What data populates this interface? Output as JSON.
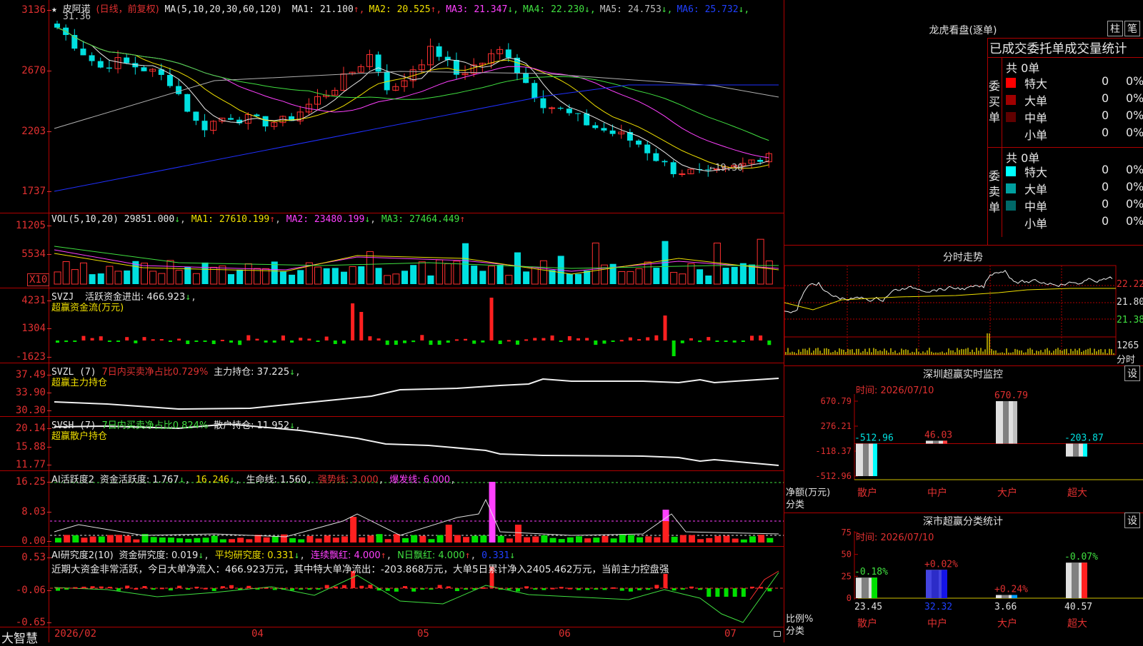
{
  "stock_name": "皮阿诺",
  "star_icon": "★",
  "period_label": "(日线，前复权)",
  "ma_header": {
    "label": "MA(5,10,20,30,60,120)",
    "items": [
      {
        "text": "MA1: 21.100",
        "arrow": "↑",
        "color": "#e8e8e8"
      },
      {
        "text": "MA2: 20.525",
        "arrow": "↑",
        "color": "#f0e000"
      },
      {
        "text": "MA3: 21.347",
        "arrow": "↓",
        "color": "#ff40ff"
      },
      {
        "text": "MA4: 22.230",
        "arrow": "↓",
        "color": "#40e040"
      },
      {
        "text": "MA5: 24.753",
        "arrow": "↓",
        "color": "#c0c0c0"
      },
      {
        "text": "MA6: 25.732",
        "arrow": "↓",
        "color": "#2040ff"
      }
    ]
  },
  "price_axis": [
    "3136",
    "2670",
    "2203",
    "1737"
  ],
  "price_annotations": {
    "high": "31.36",
    "low": "←19.30"
  },
  "vol_header": {
    "label": "VOL(5,10,20)",
    "value": "29851.000",
    "arrow": "↓",
    "ma1": "MA1: 27610.199",
    "ma1_arrow": "↑",
    "ma2": "MA2: 23480.199",
    "ma2_arrow": "↓",
    "ma3": "MA3: 27464.449",
    "ma3_arrow": "↑"
  },
  "vol_axis": [
    "11205",
    "5534"
  ],
  "vol_unit": "X10",
  "svzj": {
    "label": "SVZJ",
    "text": "活跃资金进出: 466.923",
    "arrow": "↓",
    "sub": "超赢资金流(万元)",
    "axis": [
      "4231",
      "1304",
      "-1623"
    ]
  },
  "svzl": {
    "label": "SVZL (7)",
    "ratio": "7日内买卖净占比0.729%",
    "text": "主力持仓: 37.225",
    "arrow": "↓",
    "sub": "超赢主力持仓",
    "axis": [
      "37.49",
      "33.90",
      "30.30"
    ]
  },
  "svsh": {
    "label": "SVSH (7)",
    "ratio": "7日内买卖净占比0.824%",
    "text": "散户持仓: 11.952",
    "arrow": "↓",
    "sub": "超赢散户持仓",
    "axis": [
      "20.14",
      "15.88",
      "11.77"
    ]
  },
  "ai_active": {
    "label": "AI活跃度2",
    "text": "资金活跃度: 1.767",
    "t2": "16.246",
    "t3": "生命线: 1.560",
    "t4": "强势线: 3.000",
    "t5": "爆发线: 6.000",
    "axis": [
      "16.25",
      "8.03",
      "0.00"
    ]
  },
  "ai_research": {
    "label": "AI研究度2(10)",
    "text": "资金研究度: 0.019",
    "t2": "平均研究度: 0.331",
    "t3": "连续飘红: 4.000",
    "t4": "N日飘红: 4.000",
    "t5": "0.331",
    "desc": "近期大资金非常活跃，今日大单净流入：466.923万元，其中特大单净流出：-203.868万元，大单5日累计净入2405.462万元，当前主力控盘强",
    "axis": [
      "0.53",
      "-0.06",
      "-0.65"
    ]
  },
  "x_axis": {
    "app": "大智慧",
    "labels": [
      "2026/02",
      "04",
      "05",
      "06",
      "07"
    ]
  },
  "dragon_tiger": {
    "title": "龙虎看盘(逐单)",
    "btn1": "柱",
    "btn2": "笔",
    "subtitle": "已成交委托单成交量统计",
    "buy": {
      "label": "委买单",
      "total": "共 0单",
      "rows": [
        {
          "name": "特大",
          "count": "0",
          "pct": "0%",
          "color": "#ff0000"
        },
        {
          "name": "大单",
          "count": "0",
          "pct": "0%",
          "color": "#a00000"
        },
        {
          "name": "中单",
          "count": "0",
          "pct": "0%",
          "color": "#600000"
        },
        {
          "name": "小单",
          "count": "0",
          "pct": "0%",
          "color": "#000000"
        }
      ]
    },
    "sell": {
      "label": "委卖单",
      "total": "共 0单",
      "rows": [
        {
          "name": "特大",
          "count": "0",
          "pct": "0%",
          "color": "#00ffff"
        },
        {
          "name": "大单",
          "count": "0",
          "pct": "0%",
          "color": "#00a0a0"
        },
        {
          "name": "中单",
          "count": "0",
          "pct": "0%",
          "color": "#006868"
        },
        {
          "name": "小单",
          "count": "0",
          "pct": "0%",
          "color": "#000000"
        }
      ]
    }
  },
  "intraday": {
    "title": "分时走势",
    "axis": [
      "22.22",
      "21.80",
      "21.38"
    ],
    "vol_label": "1265",
    "vol_unit": "分时"
  },
  "sz_monitor": {
    "title": "深圳超赢实时监控",
    "settings": "设",
    "time": "时间: 2026/07/10",
    "y_axis": [
      "670.79",
      "276.21",
      "-118.37",
      "-512.96"
    ],
    "ylabel": "净额(万元)",
    "xlabel": "分类",
    "categories": [
      "散户",
      "中户",
      "大户",
      "超大"
    ],
    "values": [
      -512.96,
      46.03,
      670.79,
      -203.87
    ],
    "value_labels": [
      "-512.96",
      "46.03",
      "670.79",
      "-203.87"
    ]
  },
  "sz_stats": {
    "title": "深市超赢分类统计",
    "settings": "设",
    "time": "时间: 2026/07/10",
    "y_axis": [
      "75",
      "50",
      "25",
      "0"
    ],
    "ylabel": "比例%",
    "xlabel": "分类",
    "categories": [
      "散户",
      "中户",
      "大户",
      "超大"
    ],
    "values": [
      23.45,
      32.32,
      3.66,
      40.57
    ],
    "value_labels": [
      "23.45",
      "32.32",
      "3.66",
      "40.57"
    ],
    "changes": [
      "-0.18%",
      "+0.02%",
      "+0.24%",
      "-0.07%"
    ]
  },
  "chart_data": [
    {
      "type": "bar",
      "title": "深圳超赢实时监控",
      "categories": [
        "散户",
        "中户",
        "大户",
        "超大"
      ],
      "values": [
        -512.96,
        46.03,
        670.79,
        -203.87
      ],
      "ylabel": "净额(万元)",
      "xlabel": "分类",
      "ylim": [
        -512.96,
        670.79
      ]
    },
    {
      "type": "bar",
      "title": "深市超赢分类统计",
      "categories": [
        "散户",
        "中户",
        "大户",
        "超大"
      ],
      "values": [
        23.45,
        32.32,
        3.66,
        40.57
      ],
      "ylabel": "比例%",
      "xlabel": "分类",
      "ylim": [
        0,
        75
      ]
    }
  ]
}
